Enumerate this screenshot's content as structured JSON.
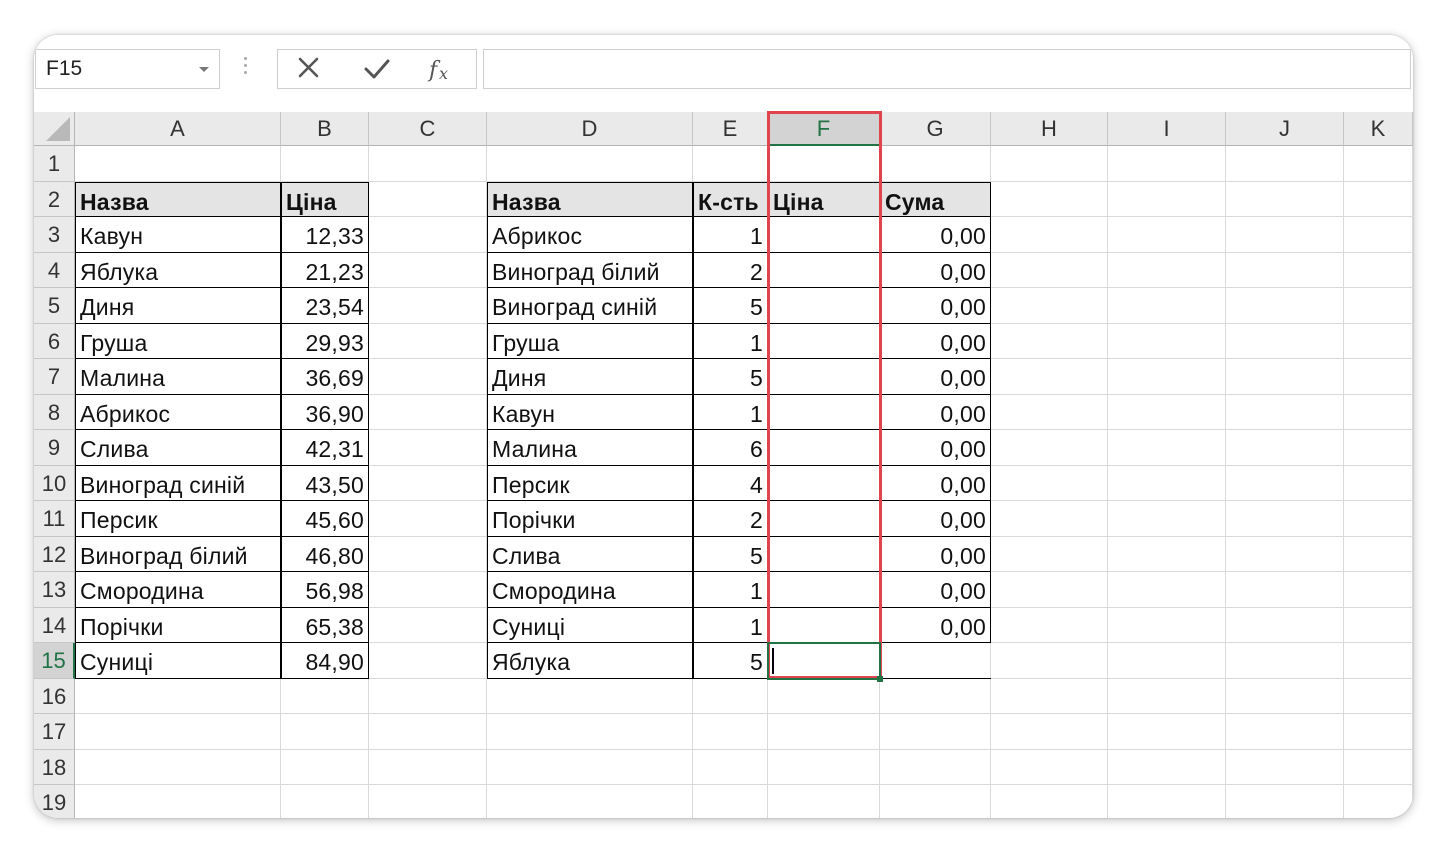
{
  "name_box": {
    "value": "F15"
  },
  "formula_bar": {
    "value": ""
  },
  "icons": {
    "cancel": "x-icon",
    "enter": "check-icon",
    "function": "fx-icon"
  },
  "colors": {
    "accent": "#217346",
    "highlight": "#e0454f",
    "header_fill": "#e4e4e4"
  },
  "columns": [
    "A",
    "B",
    "C",
    "D",
    "E",
    "F",
    "G",
    "H",
    "I",
    "J",
    "K"
  ],
  "rows": [
    "1",
    "2",
    "3",
    "4",
    "5",
    "6",
    "7",
    "8",
    "9",
    "10",
    "11",
    "12",
    "13",
    "14",
    "15",
    "16",
    "17",
    "18",
    "19"
  ],
  "selection": {
    "active_cell": "F15",
    "highlighted_column": "F"
  },
  "price_table": {
    "headers": [
      "Назва",
      "Ціна"
    ],
    "rows": [
      [
        "Кавун",
        "12,33"
      ],
      [
        "Яблука",
        "21,23"
      ],
      [
        "Диня",
        "23,54"
      ],
      [
        "Груша",
        "29,93"
      ],
      [
        "Малина",
        "36,69"
      ],
      [
        "Абрикос",
        "36,90"
      ],
      [
        "Слива",
        "42,31"
      ],
      [
        "Виноград синій",
        "43,50"
      ],
      [
        "Персик",
        "45,60"
      ],
      [
        "Виноград білий",
        "46,80"
      ],
      [
        "Смородина",
        "56,98"
      ],
      [
        "Порічки",
        "65,38"
      ],
      [
        "Суниці",
        "84,90"
      ]
    ]
  },
  "order_table": {
    "headers": [
      "Назва",
      "К-сть",
      "Ціна",
      "Сума"
    ],
    "rows": [
      [
        "Абрикос",
        "1",
        "",
        "0,00"
      ],
      [
        "Виноград білий",
        "2",
        "",
        "0,00"
      ],
      [
        "Виноград синій",
        "5",
        "",
        "0,00"
      ],
      [
        "Груша",
        "1",
        "",
        "0,00"
      ],
      [
        "Диня",
        "5",
        "",
        "0,00"
      ],
      [
        "Кавун",
        "1",
        "",
        "0,00"
      ],
      [
        "Малина",
        "6",
        "",
        "0,00"
      ],
      [
        "Персик",
        "4",
        "",
        "0,00"
      ],
      [
        "Порічки",
        "2",
        "",
        "0,00"
      ],
      [
        "Слива",
        "5",
        "",
        "0,00"
      ],
      [
        "Смородина",
        "1",
        "",
        "0,00"
      ],
      [
        "Суниці",
        "1",
        "",
        "0,00"
      ],
      [
        "Яблука",
        "5",
        "",
        ""
      ]
    ]
  }
}
